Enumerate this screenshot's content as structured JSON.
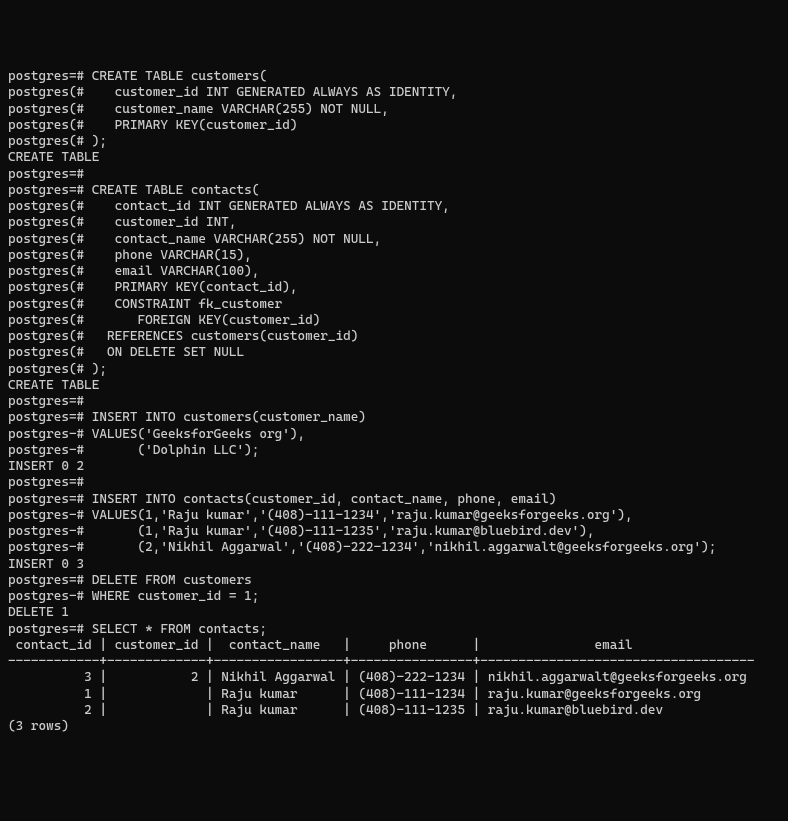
{
  "lines": [
    "postgres=# CREATE TABLE customers(",
    "postgres(#    customer_id INT GENERATED ALWAYS AS IDENTITY,",
    "postgres(#    customer_name VARCHAR(255) NOT NULL,",
    "postgres(#    PRIMARY KEY(customer_id)",
    "postgres(# );",
    "CREATE TABLE",
    "postgres=#",
    "postgres=# CREATE TABLE contacts(",
    "postgres(#    contact_id INT GENERATED ALWAYS AS IDENTITY,",
    "postgres(#    customer_id INT,",
    "postgres(#    contact_name VARCHAR(255) NOT NULL,",
    "postgres(#    phone VARCHAR(15),",
    "postgres(#    email VARCHAR(100),",
    "postgres(#    PRIMARY KEY(contact_id),",
    "postgres(#    CONSTRAINT fk_customer",
    "postgres(#       FOREIGN KEY(customer_id)",
    "postgres(#   REFERENCES customers(customer_id)",
    "postgres(#   ON DELETE SET NULL",
    "postgres(# );",
    "CREATE TABLE",
    "postgres=#",
    "postgres=# INSERT INTO customers(customer_name)",
    "postgres-# VALUES('GeeksforGeeks org'),",
    "postgres-#       ('Dolphin LLC');",
    "INSERT 0 2",
    "postgres=#",
    "postgres=# INSERT INTO contacts(customer_id, contact_name, phone, email)",
    "postgres-# VALUES(1,'Raju kumar','(408)-111-1234','raju.kumar@geeksforgeeks.org'),",
    "postgres-#       (1,'Raju kumar','(408)-111-1235','raju.kumar@bluebird.dev'),",
    "postgres-#       (2,'Nikhil Aggarwal','(408)-222-1234','nikhil.aggarwalt@geeksforgeeks.org');",
    "INSERT 0 3",
    "postgres=# DELETE FROM customers",
    "postgres-# WHERE customer_id = 1;",
    "DELETE 1",
    "postgres=# SELECT * FROM contacts;",
    " contact_id | customer_id |  contact_name   |     phone      |               email",
    "------------+-------------+-----------------+----------------+------------------------------------",
    "          3 |           2 | Nikhil Aggarwal | (408)-222-1234 | nikhil.aggarwalt@geeksforgeeks.org",
    "          1 |             | Raju kumar      | (408)-111-1234 | raju.kumar@geeksforgeeks.org",
    "          2 |             | Raju kumar      | (408)-111-1235 | raju.kumar@bluebird.dev",
    "(3 rows)"
  ],
  "chart_data": {
    "type": "table",
    "title": "SELECT * FROM contacts",
    "columns": [
      "contact_id",
      "customer_id",
      "contact_name",
      "phone",
      "email"
    ],
    "rows": [
      {
        "contact_id": 3,
        "customer_id": 2,
        "contact_name": "Nikhil Aggarwal",
        "phone": "(408)-222-1234",
        "email": "nikhil.aggarwalt@geeksforgeeks.org"
      },
      {
        "contact_id": 1,
        "customer_id": null,
        "contact_name": "Raju kumar",
        "phone": "(408)-111-1234",
        "email": "raju.kumar@geeksforgeeks.org"
      },
      {
        "contact_id": 2,
        "customer_id": null,
        "contact_name": "Raju kumar",
        "phone": "(408)-111-1235",
        "email": "raju.kumar@bluebird.dev"
      }
    ],
    "row_count_label": "(3 rows)"
  }
}
